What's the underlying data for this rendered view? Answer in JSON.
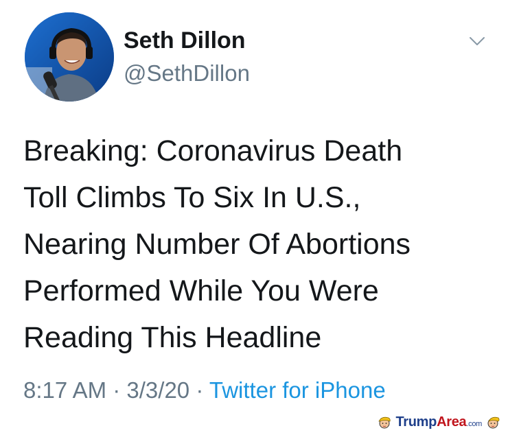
{
  "tweet": {
    "author_name": "Seth Dillon",
    "author_handle": "@SethDillon",
    "text_lines": [
      "Breaking: Coronavirus Death",
      "Toll Climbs To Six In U.S.,",
      "Nearing Number Of Abortions",
      "Performed While You Were",
      "Reading This Headline"
    ],
    "time": "8:17 AM",
    "separator": " · ",
    "date": "3/3/20",
    "source": "Twitter for iPhone",
    "menu_icon": "chevron-down-icon"
  },
  "watermark": {
    "brand_part1": "Trump",
    "brand_part2": "Area",
    "brand_suffix": ".com",
    "icon": "trump-face-icon"
  },
  "colors": {
    "text": "#14171a",
    "secondary": "#657786",
    "link": "#1b95e0"
  }
}
